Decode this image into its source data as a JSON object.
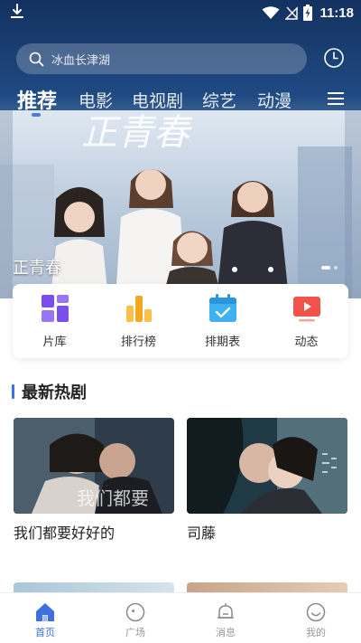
{
  "status_bar": {
    "time": "11:18"
  },
  "search": {
    "placeholder": "冰血长津湖"
  },
  "tabs": [
    {
      "label": "推荐",
      "active": true
    },
    {
      "label": "电影",
      "active": false
    },
    {
      "label": "电视剧",
      "active": false
    },
    {
      "label": "综艺",
      "active": false
    },
    {
      "label": "动漫",
      "active": false
    }
  ],
  "banner": {
    "title": "正青春",
    "artwork_text": "正青春",
    "slide_count": 2,
    "active_slide": 1
  },
  "quick_entries": [
    {
      "label": "片库",
      "icon": "library-grid-icon"
    },
    {
      "label": "排行榜",
      "icon": "ranking-bars-icon"
    },
    {
      "label": "排期表",
      "icon": "calendar-check-icon"
    },
    {
      "label": "动态",
      "icon": "video-play-icon"
    }
  ],
  "section": {
    "title": "最新热剧"
  },
  "dramas": [
    {
      "title": "我们都要好好的",
      "poster_text": "我们都要"
    },
    {
      "title": "司藤",
      "poster_text": ""
    }
  ],
  "bottom_nav": [
    {
      "label": "首页",
      "icon": "home-icon",
      "active": true
    },
    {
      "label": "广场",
      "icon": "square-icon",
      "active": false
    },
    {
      "label": "消息",
      "icon": "bell-icon",
      "active": false
    },
    {
      "label": "我的",
      "icon": "profile-smile-icon",
      "active": false
    }
  ],
  "colors": {
    "accent": "#3d6fe0",
    "header_top": "#13315f",
    "section_bar": "#3d72e8"
  }
}
